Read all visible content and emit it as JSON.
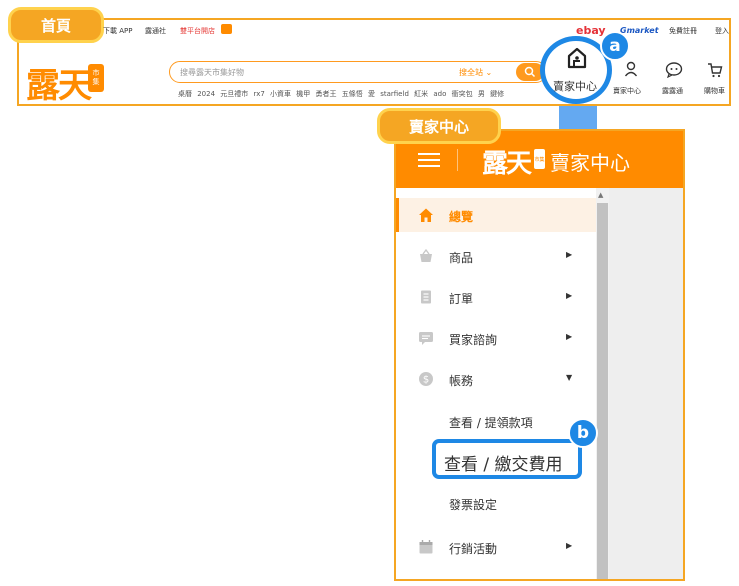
{
  "tags": {
    "home": "首頁",
    "seller_center": "賣家中心"
  },
  "homepage": {
    "topbar_left": [
      "下載 APP",
      "露通社"
    ],
    "topbar_promo": "雙平台開店",
    "topbar_right": [
      "免費註冊",
      "登入"
    ],
    "partner_logos": [
      "ebay",
      "Gmarket"
    ],
    "logo_text": "露天",
    "logo_seal": [
      "市",
      "集"
    ],
    "search": {
      "placeholder": "搜尋露天市集好物",
      "scope": "搜全站"
    },
    "hot_keywords": [
      "桌曆 2024",
      "元旦禮市",
      "rx7",
      "小資車",
      "機甲 勇者王",
      "五條悟 愛",
      "starfield",
      "紅米",
      "ado",
      "衝突包 男",
      "鍵修"
    ],
    "header_icons": [
      {
        "icon": "seller-center-icon",
        "label": "賣家中心"
      },
      {
        "icon": "user-icon",
        "label": "賣家中心"
      },
      {
        "icon": "chat-icon",
        "label": "露露通"
      },
      {
        "icon": "cart-icon",
        "label": "購物車"
      }
    ]
  },
  "badges": {
    "a": "a",
    "b": "b"
  },
  "seller_panel": {
    "logo_text": "露天",
    "logo_seal": "市集",
    "title": "賣家中心",
    "menu": [
      {
        "icon": "home-icon",
        "label": "總覽",
        "active": true
      },
      {
        "icon": "basket-icon",
        "label": "商品",
        "caret": "right"
      },
      {
        "icon": "order-icon",
        "label": "訂單",
        "caret": "right"
      },
      {
        "icon": "message-icon",
        "label": "買家諮詢",
        "caret": "right"
      },
      {
        "icon": "money-icon",
        "label": "帳務",
        "caret": "down"
      },
      {
        "icon": "calendar-icon",
        "label": "行銷活動",
        "caret": "right"
      }
    ],
    "account_submenu": [
      "查看 / 提領款項",
      "查看 / 繳交費用",
      "發票設定"
    ]
  },
  "colors": {
    "accent": "#ff8b00",
    "highlight": "#1e88e5",
    "tag": "#f5a623"
  }
}
